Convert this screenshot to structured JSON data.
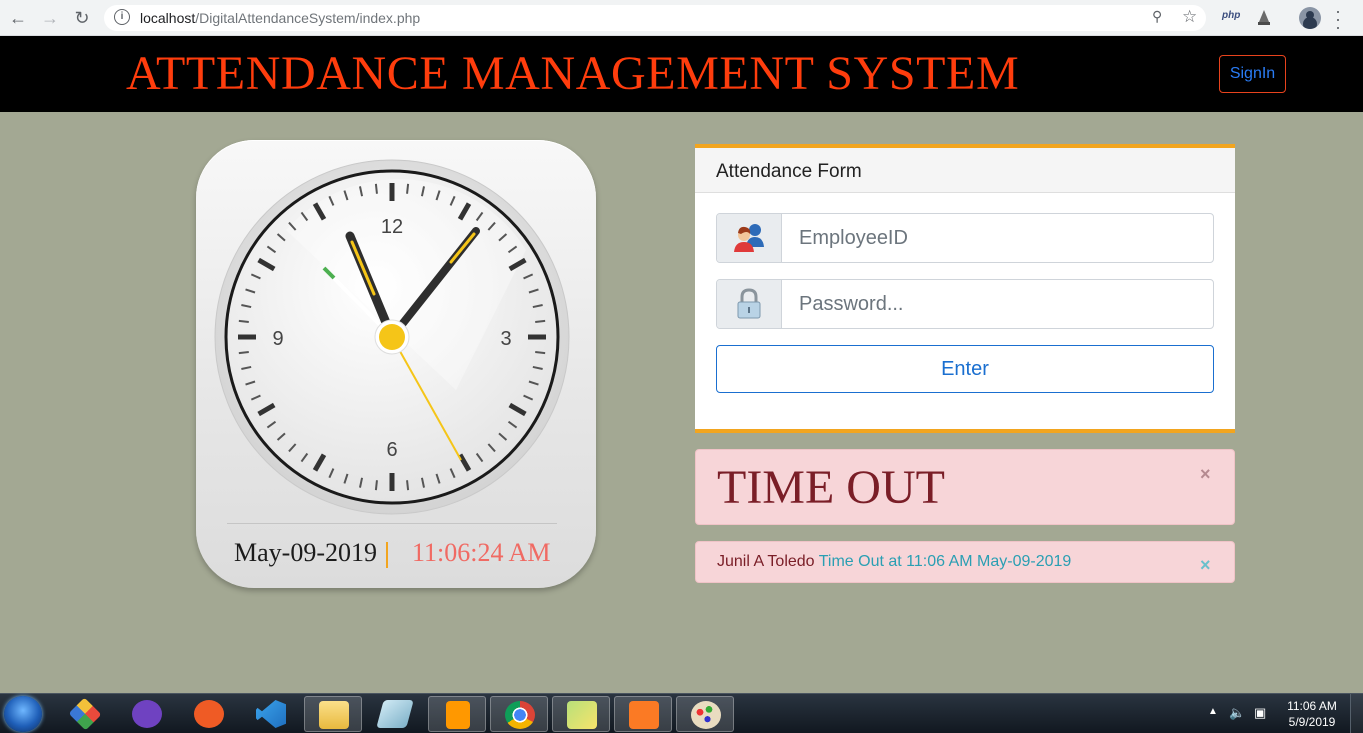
{
  "browser": {
    "url_host": "localhost",
    "url_path": "/DigitalAttendanceSystem/index.php",
    "extension_label": "php"
  },
  "header": {
    "title": "ATTENDANCE MANAGEMENT SYSTEM",
    "signin_label": "SignIn"
  },
  "clock": {
    "numerals": [
      "12",
      "3",
      "6",
      "9"
    ],
    "date": "May-09-2019",
    "time": "11:06:24 AM"
  },
  "form": {
    "title": "Attendance Form",
    "employee_placeholder": "EmployeeID",
    "password_placeholder": "Password...",
    "enter_label": "Enter"
  },
  "alerts": {
    "big_message": "TIME OUT",
    "close_glyph": "×",
    "employee_name": "Junil A Toledo",
    "detail": "Time Out at 11:06 AM May-09-2019"
  },
  "taskbar": {
    "time": "11:06 AM",
    "date": "5/9/2019",
    "apps": [
      "start",
      "git-kraken",
      "github-desktop",
      "postman",
      "vscode",
      "file-explorer",
      "notepad",
      "sublime-text",
      "chrome",
      "sticky-notes",
      "xampp",
      "paint"
    ]
  },
  "colors": {
    "title_red": "#ff3d0d",
    "accent_orange": "#f2a51f",
    "link_blue": "#1a6fd0",
    "alert_pink": "#f7d5d8",
    "alert_text": "#7a1e27",
    "alert_detail": "#2a9fb3",
    "page_bg": "#a3a893"
  }
}
